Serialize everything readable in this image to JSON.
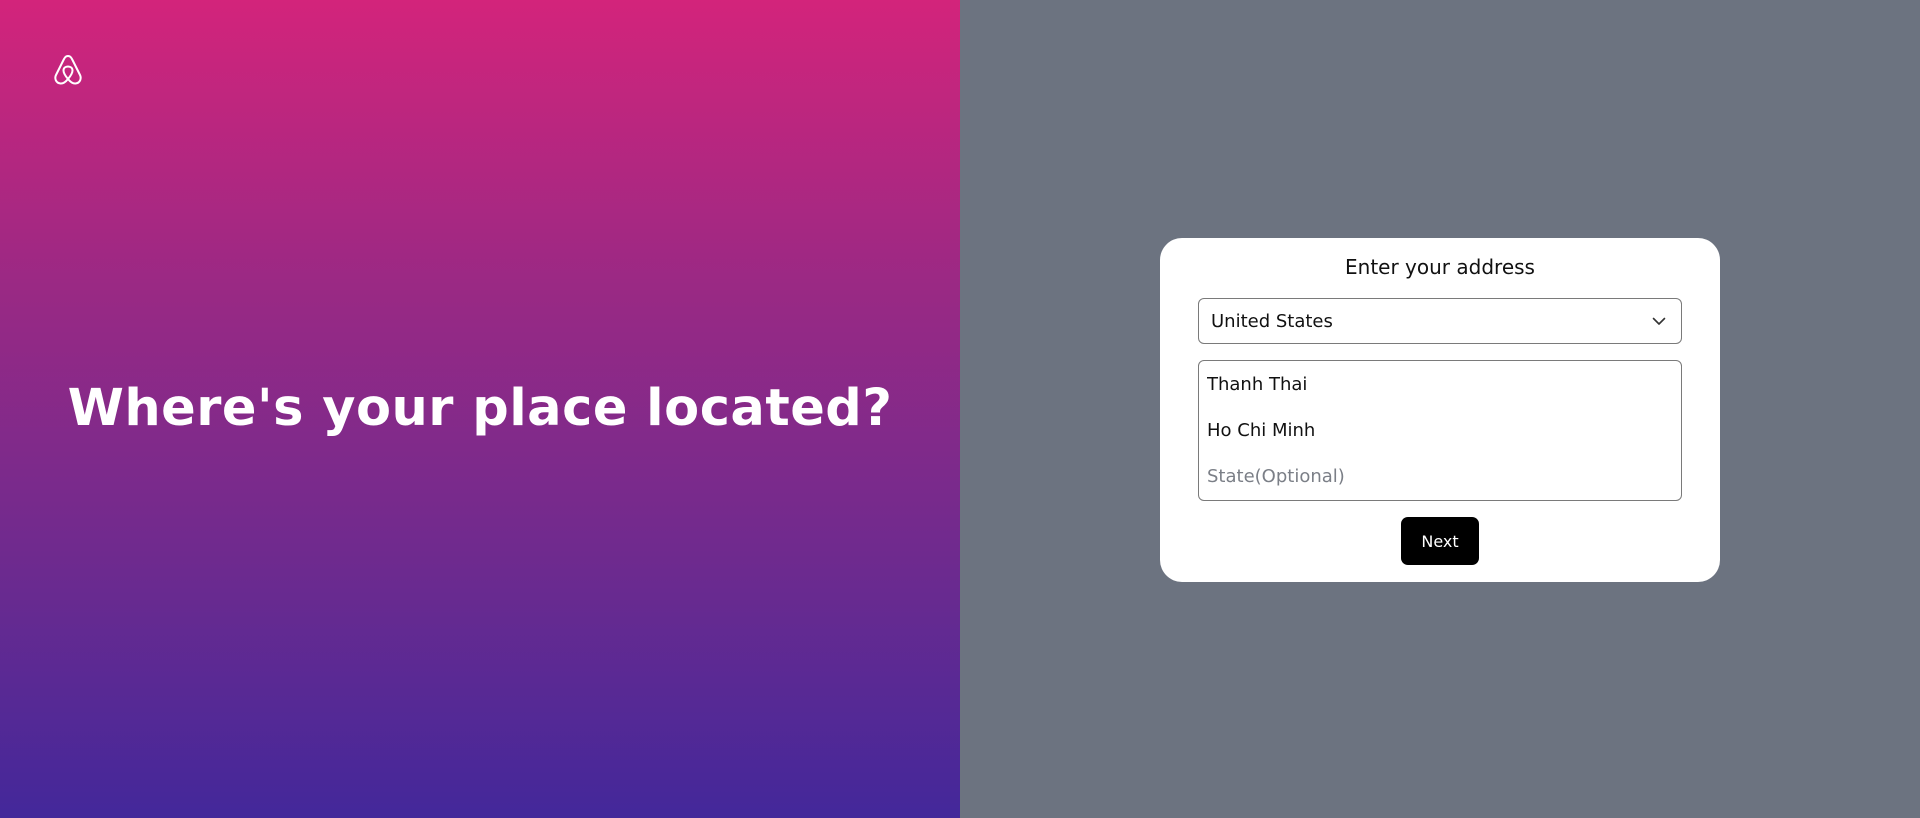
{
  "left": {
    "logo_icon": "airbnb-logo-icon",
    "heading": "Where's your place located?",
    "colors": {
      "gradient_top": "#d3247b",
      "gradient_bottom": "#43289a"
    }
  },
  "form": {
    "title": "Enter your address",
    "country": {
      "selected": "United States",
      "icon": "chevron-down-icon"
    },
    "street": {
      "value": "Thanh Thai"
    },
    "city": {
      "value": "Ho Chi Minh"
    },
    "state": {
      "value": "",
      "placeholder": "State(Optional)"
    },
    "next_label": "Next",
    "colors": {
      "background": "#6c7380",
      "card": "#ffffff",
      "button": "#000000"
    }
  }
}
